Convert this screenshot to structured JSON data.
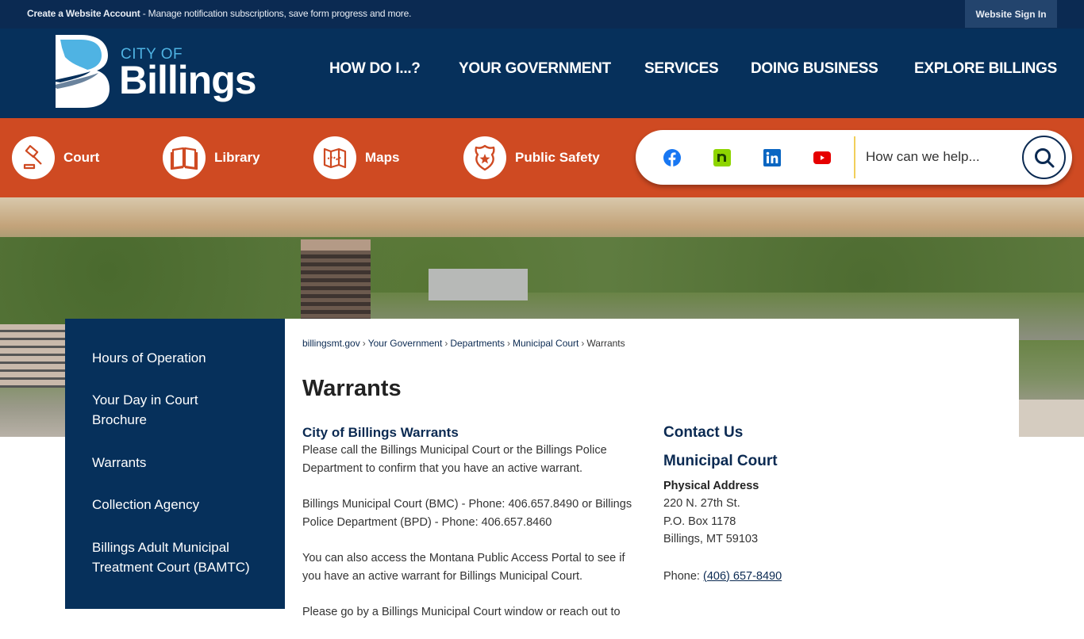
{
  "topbar": {
    "account_link": "Create a Website Account",
    "account_desc": " - Manage notification subscriptions, save form progress and more.",
    "signin": "Website Sign In"
  },
  "logo": {
    "line1": "CITY OF",
    "line2": "Billings"
  },
  "mainnav": [
    {
      "label": "HOW DO I...?"
    },
    {
      "label": "YOUR GOVERNMENT"
    },
    {
      "label": "SERVICES"
    },
    {
      "label": "DOING BUSINESS"
    },
    {
      "label": "EXPLORE BILLINGS"
    }
  ],
  "quicklinks": [
    {
      "label": "Court",
      "icon": "gavel-icon"
    },
    {
      "label": "Library",
      "icon": "book-icon"
    },
    {
      "label": "Maps",
      "icon": "map-icon"
    },
    {
      "label": "Public Safety",
      "icon": "badge-icon"
    }
  ],
  "social": [
    {
      "name": "facebook",
      "color": "#1877f2"
    },
    {
      "name": "nextdoor",
      "color": "#8ed500"
    },
    {
      "name": "linkedin",
      "color": "#0a66c2"
    },
    {
      "name": "youtube",
      "color": "#e60000"
    }
  ],
  "search": {
    "placeholder": "How can we help..."
  },
  "colors": {
    "navy": "#06305b",
    "orange": "#cf4a22",
    "accent_yellow": "#f1cf5a"
  },
  "sidebar": {
    "items": [
      {
        "label": "Hours of Operation"
      },
      {
        "label": "Your Day in Court Brochure"
      },
      {
        "label": "Warrants"
      },
      {
        "label": "Collection Agency"
      },
      {
        "label": "Billings Adult Municipal Treatment Court (BAMTC)"
      }
    ]
  },
  "breadcrumb": [
    {
      "label": "billingsmt.gov"
    },
    {
      "label": "Your Government"
    },
    {
      "label": "Departments"
    },
    {
      "label": "Municipal Court"
    },
    {
      "label": "Warrants"
    }
  ],
  "breadcrumb_sep": "›",
  "page_title": "Warrants",
  "main": {
    "heading": "City of Billings Warrants",
    "paragraphs": [
      "Please call the Billings Municipal Court or the Billings Police Department to confirm that you have an active warrant.",
      "Billings Municipal Court (BMC) -  Phone: 406.657.8490 or Billings Police Department (BPD) - Phone: 406.657.8460",
      "You can also access the Montana Public Access Portal to see if you have an active warrant for Billings Municipal Court.",
      "Please go by a Billings Municipal Court window or reach out to"
    ]
  },
  "contact": {
    "heading": "Contact Us",
    "org": "Municipal Court",
    "address_label": "Physical Address",
    "address_lines": [
      "220 N. 27th St.",
      "P.O. Box 1178",
      "Billings, MT 59103"
    ],
    "phone_label": "Phone: ",
    "phone": "(406) 657-8490"
  }
}
